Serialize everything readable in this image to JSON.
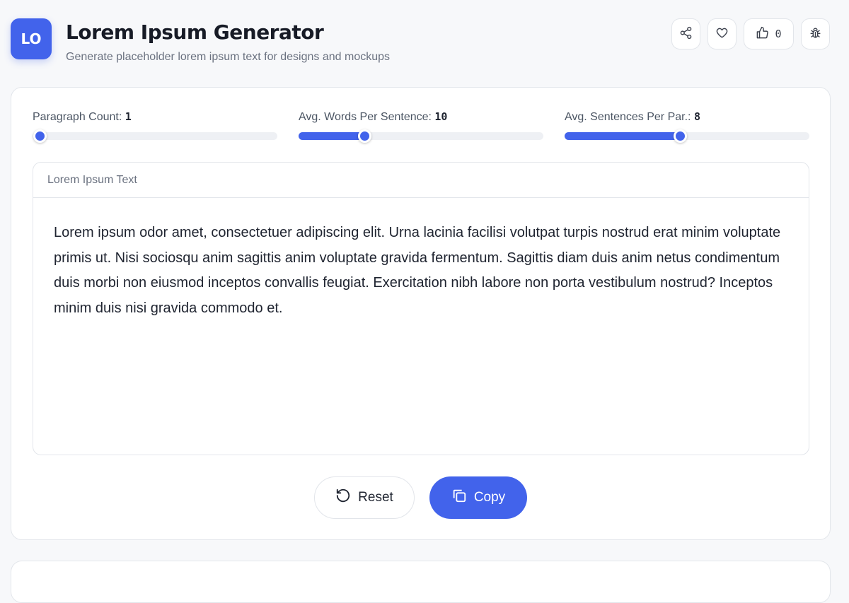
{
  "header": {
    "logo_text": "LO",
    "title": "Lorem Ipsum Generator",
    "subtitle": "Generate placeholder lorem ipsum text for designs and mockups",
    "like_count": "0"
  },
  "sliders": [
    {
      "label": "Paragraph Count:",
      "value": "1",
      "fraction": 0.0
    },
    {
      "label": "Avg. Words Per Sentence:",
      "value": "10",
      "fraction": 0.27
    },
    {
      "label": "Avg. Sentences Per Par.:",
      "value": "8",
      "fraction": 0.47
    }
  ],
  "panel": {
    "label": "Lorem Ipsum Text",
    "text": "Lorem ipsum odor amet, consectetuer adipiscing elit. Urna lacinia facilisi volutpat turpis nostrud erat minim voluptate primis ut. Nisi sociosqu anim sagittis anim voluptate gravida fermentum. Sagittis diam duis anim netus condimentum duis morbi non eiusmod inceptos convallis feugiat. Exercitation nibh labore non porta vestibulum nostrud? Inceptos minim duis nisi gravida commodo et."
  },
  "buttons": {
    "reset_label": "Reset",
    "copy_label": "Copy"
  },
  "icons": {
    "share": "share-icon",
    "favorite": "heart-icon",
    "like": "thumbs-up-icon",
    "report": "bug-icon",
    "reset": "rotate-ccw-icon",
    "copy": "copy-icon"
  },
  "colors": {
    "accent": "#4263eb",
    "background": "#f7f8fa",
    "card": "#ffffff",
    "border": "#e3e6eb"
  }
}
